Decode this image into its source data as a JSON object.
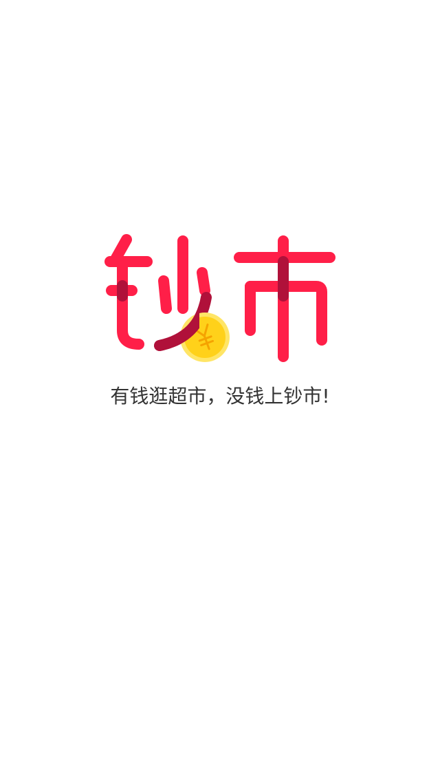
{
  "logo": {
    "text": "钞市",
    "colors": {
      "primary": "#ff1f48",
      "dark": "#b0113a",
      "coin": "#ffd11a",
      "coin_rim": "#ffe566",
      "coin_symbol": "#f5a300"
    },
    "coin_icon": "yen-coin-icon"
  },
  "slogan": "有钱逛超市，没钱上钞市!"
}
